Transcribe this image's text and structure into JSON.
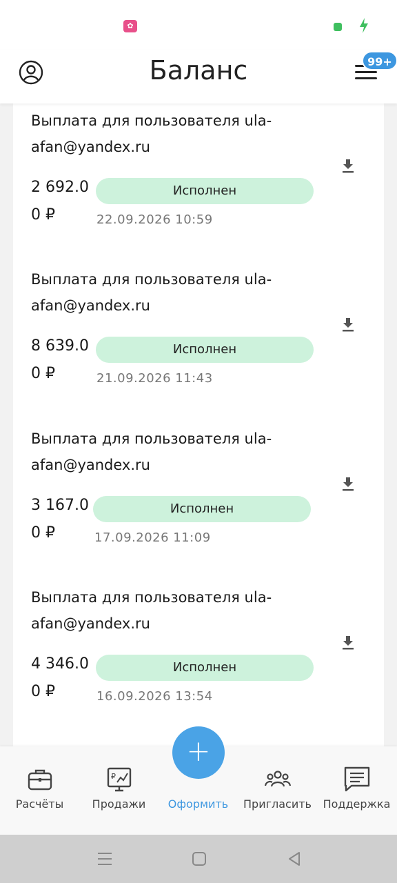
{
  "header": {
    "title": "Баланс",
    "badge": "99+"
  },
  "payouts": [
    {
      "title": "Выплата для пользователя ula-afan@yandex.ru",
      "amount_line1": "2 692.0",
      "amount_line2": "0 ₽",
      "status": "Исполнен",
      "datetime": "22.09.2026 10:59"
    },
    {
      "title": "Выплата для пользователя ula-afan@yandex.ru",
      "amount_line1": "8 639.0",
      "amount_line2": "0 ₽",
      "status": "Исполнен",
      "datetime": "21.09.2026 11:43"
    },
    {
      "title": "Выплата для пользователя ula-afan@yandex.ru",
      "amount_line1": "3 167.0",
      "amount_line2": "0 ₽",
      "status": "Исполнен",
      "datetime": "17.09.2026 11:09"
    },
    {
      "title": "Выплата для пользователя ula-afan@yandex.ru",
      "amount_line1": "4 346.0",
      "amount_line2": "0 ₽",
      "status": "Исполнен",
      "datetime": "16.09.2026 13:54"
    }
  ],
  "bottom_nav": {
    "items": [
      {
        "label": "Расчёты",
        "icon": "briefcase-icon"
      },
      {
        "label": "Продажи",
        "icon": "sales-monitor-icon"
      },
      {
        "label": "Оформить",
        "icon": "plus-icon",
        "active": true
      },
      {
        "label": "Пригласить",
        "icon": "people-icon"
      },
      {
        "label": "Поддержка",
        "icon": "chat-icon"
      }
    ],
    "fab_symbol": "+"
  },
  "colors": {
    "accent": "#3d97e0",
    "status_pill": "#cdf2dc",
    "status_text_muted": "#777777"
  }
}
